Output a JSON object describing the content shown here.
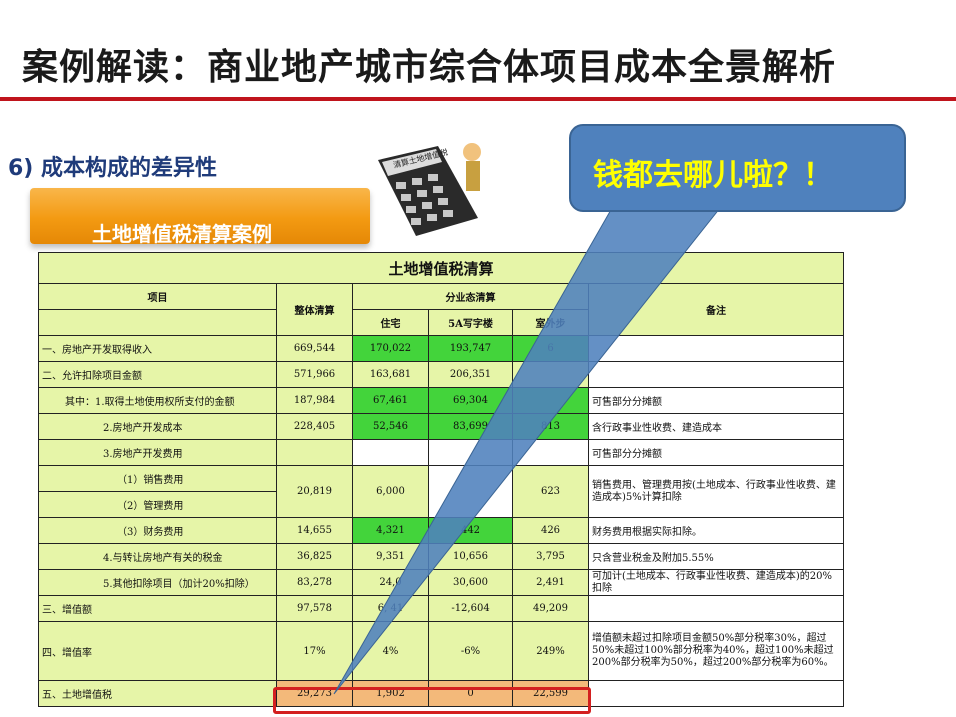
{
  "title": "案例解读：商业地产城市综合体项目成本全景解析",
  "subtitle": "6) 成本构成的差异性",
  "banner": "土地增值税清算案例",
  "callout": "钱都去哪儿啦？！",
  "calc_label": "清算土地增值税",
  "table": {
    "title": "土地增值税清算",
    "h_item": "项目",
    "h_total": "整体清算",
    "h_split": "分业态清算",
    "h_note": "备注",
    "h_res": "住宅",
    "h_office": "5A写字楼",
    "h_outdoor": "室外步",
    "rows": [
      {
        "item": "一、房地产开发取得收入",
        "total": "669,544",
        "res": "170,022",
        "office": "193,747",
        "out": "6",
        "note": ""
      },
      {
        "item": "二、允许扣除项目金额",
        "total": "571,966",
        "res": "163,681",
        "office": "206,351",
        "out": "",
        "note": ""
      },
      {
        "item": "其中：1.取得土地使用权所支付的金额",
        "total": "187,984",
        "res": "67,461",
        "office": "69,304",
        "out": "",
        "note": "可售部分分摊额"
      },
      {
        "item": "2.房地产开发成本",
        "total": "228,405",
        "res": "52,546",
        "office": "83,699",
        "out": "813",
        "note": "含行政事业性收费、建造成本"
      },
      {
        "item": "3.房地产开发费用",
        "total": "",
        "res": "",
        "office": "",
        "out": "",
        "note": "可售部分分摊额"
      },
      {
        "item": "（1）销售费用",
        "total": "20,819",
        "res": "6,000",
        "office": "",
        "out": "623",
        "note": "销售费用、管理费用按(土地成本、行政事业性收费、建造成本)5%计算扣除"
      },
      {
        "item": "（2）管理费用",
        "total": "",
        "res": "",
        "office": "",
        "out": "",
        "note": ""
      },
      {
        "item": "（3）财务费用",
        "total": "14,655",
        "res": "4,321",
        "office": "442",
        "out": "426",
        "note": "财务费用根据实际扣除。"
      },
      {
        "item": "4.与转让房地产有关的税金",
        "total": "36,825",
        "res": "9,351",
        "office": "10,656",
        "out": "3,795",
        "note": "只含营业税金及附加5.55%"
      },
      {
        "item": "5.其他扣除项目（加计20%扣除）",
        "total": "83,278",
        "res": "24,0",
        "office": "30,600",
        "out": "2,491",
        "note": "可加计(土地成本、行政事业性收费、建造成本)的20%扣除"
      },
      {
        "item": "三、增值额",
        "total": "97,578",
        "res": "6,   41",
        "office": "-12,604",
        "out": "49,209",
        "note": ""
      },
      {
        "item": "四、增值率",
        "total": "17%",
        "res": "4%",
        "office": "-6%",
        "out": "249%",
        "note": "增值额未超过扣除项目金额50%部分税率30%，超过50%未超过100%部分税率为40%，超过100%未超过200%部分税率为50%，超过200%部分税率为60%。"
      },
      {
        "item": "五、土地增值税",
        "total": "29,273",
        "res": "1,902",
        "office": "0",
        "out": "22,599",
        "note": ""
      }
    ]
  }
}
